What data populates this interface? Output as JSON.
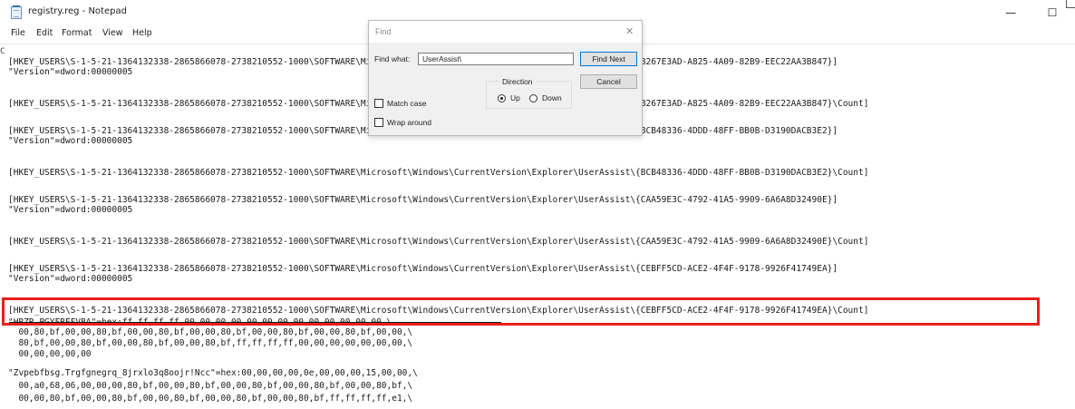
{
  "window": {
    "title": "registry.reg - Notepad",
    "minimize_glyph": "—",
    "maximize_glyph": "☐"
  },
  "menu": [
    "File",
    "Edit",
    "Format",
    "View",
    "Help"
  ],
  "editor": {
    "lines": [
      {
        "text": "[HKEY_USERS\\S-1-5-21-1364132338-2865866078-2738210552-1000\\SOFTWARE\\Microsoft\\Windows\\CurrentVersion\\Explorer\\UserAssist\\{B267E3AD-A825-4A09-82B9-EEC22AA3B847}]"
      },
      {
        "text": "\"Version\"=dword:00000005"
      },
      {
        "text": "[HKEY_USERS\\S-1-5-21-1364132338-2865866078-2738210552-1000\\SOFTWARE\\Microsoft\\Windows\\CurrentVersion\\Explorer\\UserAssist\\{B267E3AD-A825-4A09-82B9-EEC22AA3B847}\\Count]"
      },
      {
        "text": "[HKEY_USERS\\S-1-5-21-1364132338-2865866078-2738210552-1000\\SOFTWARE\\Microsoft\\Windows\\CurrentVersion\\Explorer\\UserAssist\\{BCB48336-4DDD-48FF-BB0B-D3190DACB3E2}]"
      },
      {
        "text": "\"Version\"=dword:00000005"
      },
      {
        "text": "[HKEY_USERS\\S-1-5-21-1364132338-2865866078-2738210552-1000\\SOFTWARE\\Microsoft\\Windows\\CurrentVersion\\Explorer\\UserAssist\\{BCB48336-4DDD-48FF-BB0B-D3190DACB3E2}\\Count]"
      },
      {
        "text": "[HKEY_USERS\\S-1-5-21-1364132338-2865866078-2738210552-1000\\SOFTWARE\\Microsoft\\Windows\\CurrentVersion\\Explorer\\UserAssist\\{CAA59E3C-4792-41A5-9909-6A6A8D32490E}]"
      },
      {
        "text": "\"Version\"=dword:00000005"
      },
      {
        "text": "[HKEY_USERS\\S-1-5-21-1364132338-2865866078-2738210552-1000\\SOFTWARE\\Microsoft\\Windows\\CurrentVersion\\Explorer\\UserAssist\\{CAA59E3C-4792-41A5-9909-6A6A8D32490E}\\Count]"
      },
      {
        "text": "[HKEY_USERS\\S-1-5-21-1364132338-2865866078-2738210552-1000\\SOFTWARE\\Microsoft\\Windows\\CurrentVersion\\Explorer\\UserAssist\\{CEBFF5CD-ACE2-4F4F-9178-9926F41749EA}]"
      },
      {
        "text": "\"Version\"=dword:00000005"
      },
      {
        "text": "[HKEY_USERS\\S-1-5-21-1364132338-2865866078-2738210552-1000\\SOFTWARE\\Microsoft\\Windows\\CurrentVersion\\Explorer\\UserAssist\\{CEBFF5CD-ACE2-4F4F-9178-9926F41749EA}\\Count]"
      },
      {
        "text": "\"HRZR_PGYFRFFVBA\"=hex:ff,ff,ff,ff,00,00,00,00,00,00,00,00,00,00,00,00,00,\\"
      },
      {
        "text": "  00,80,bf,00,00,80,bf,00,00,80,bf,00,00,80,bf,00,00,80,bf,00,00,80,bf,00,00,\\"
      },
      {
        "text": "  80,bf,00,00,80,bf,00,00,80,bf,00,00,80,bf,ff,ff,ff,ff,00,00,00,00,00,00,00,\\"
      },
      {
        "text": "  00,00,00,00,00"
      },
      {
        "text": "\"Zvpebfbsg.Trgfgnegrq_8jrxlo3q8oojr!Ncc\"=hex:00,00,00,00,0e,00,00,00,15,00,00,\\"
      },
      {
        "text": "  00,a0,68,06,00,00,00,80,bf,00,00,80,bf,00,00,80,bf,00,00,80,bf,00,00,80,bf,\\"
      },
      {
        "text": "  00,00,80,bf,00,00,80,bf,00,00,80,bf,00,00,80,bf,00,00,80,bf,ff,ff,ff,ff,e1,\\"
      }
    ],
    "edge_glyph": "C"
  },
  "find_dialog": {
    "title": "Find",
    "close_glyph": "✕",
    "find_what_label": "Find what:",
    "find_what_value": "UserAssist\\",
    "find_next_label": "Find Next",
    "cancel_label": "Cancel",
    "direction_label": "Direction",
    "up_label": "Up",
    "down_label": "Down",
    "direction_selected": "Up",
    "match_case_label": "Match case",
    "match_case_checked": false,
    "wrap_around_label": "Wrap around",
    "wrap_around_checked": false
  },
  "highlight": {
    "color": "#e8201c"
  }
}
